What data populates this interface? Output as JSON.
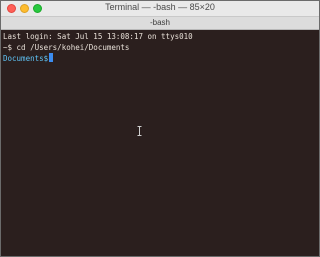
{
  "window": {
    "title": "Terminal — -bash — 85×20"
  },
  "tab": {
    "label": "-bash"
  },
  "terminal": {
    "lines": [
      "Last login: Sat Jul 15 13:08:17 on ttys010",
      "~$ cd /Users/kohei/Documents"
    ],
    "prompt_dir": "Documents$",
    "cursor_color": "#3c8cf0",
    "background": "#2b1f1e"
  },
  "traffic_lights": {
    "close_color": "#ff5f57",
    "minimize_color": "#febc2e",
    "zoom_color": "#28c840"
  }
}
